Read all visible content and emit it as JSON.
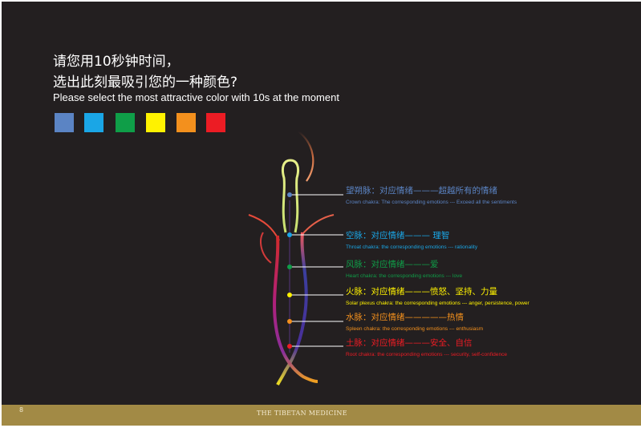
{
  "question": {
    "line1": "请您用10秒钟时间，",
    "line2": "选出此刻最吸引您的一种颜色?",
    "english": "Please select the most attractive color with 10s at the moment"
  },
  "swatches": [
    {
      "name": "color-swatch-violet-blue",
      "color": "#5b84c4"
    },
    {
      "name": "color-swatch-sky-blue",
      "color": "#1aa6e6"
    },
    {
      "name": "color-swatch-green",
      "color": "#0f9e48"
    },
    {
      "name": "color-swatch-yellow",
      "color": "#fff200"
    },
    {
      "name": "color-swatch-orange",
      "color": "#f3901d"
    },
    {
      "name": "color-swatch-red",
      "color": "#ec1c24"
    }
  ],
  "chakras": [
    {
      "cn": "望朔脉：对应情绪———超越所有的情绪",
      "en": "Crown chakra: The corresponding emotions --- Exceed all the sentiments",
      "color": "#5b84c4"
    },
    {
      "cn": "空脉：对应情绪——— 理智",
      "en": "Throat chakra: the corresponding emotions --- rationality",
      "color": "#1aa6e6"
    },
    {
      "cn": "风脉：对应情绪———爱",
      "en": "Heart chakra: the corresponding emotions --- love",
      "color": "#0f9e48"
    },
    {
      "cn": "火脉：对应情绪———愤怒、坚持、力量",
      "en": "Solar plexus chakra: the corresponding emotions --- anger, persistence, power",
      "color": "#fff200"
    },
    {
      "cn": "水脉：对应情绪—————热情",
      "en": "Spleen chakra: the corresponding emotions --- enthusiasm",
      "color": "#f3901d"
    },
    {
      "cn": "土脉：对应情绪———安全、自信",
      "en": "Root chakra: the corresponding emotions --- security, self-confidence",
      "color": "#ec1c24"
    }
  ],
  "footer": {
    "page_number": "8",
    "title": "THE TIBETAN MEDICINE"
  }
}
